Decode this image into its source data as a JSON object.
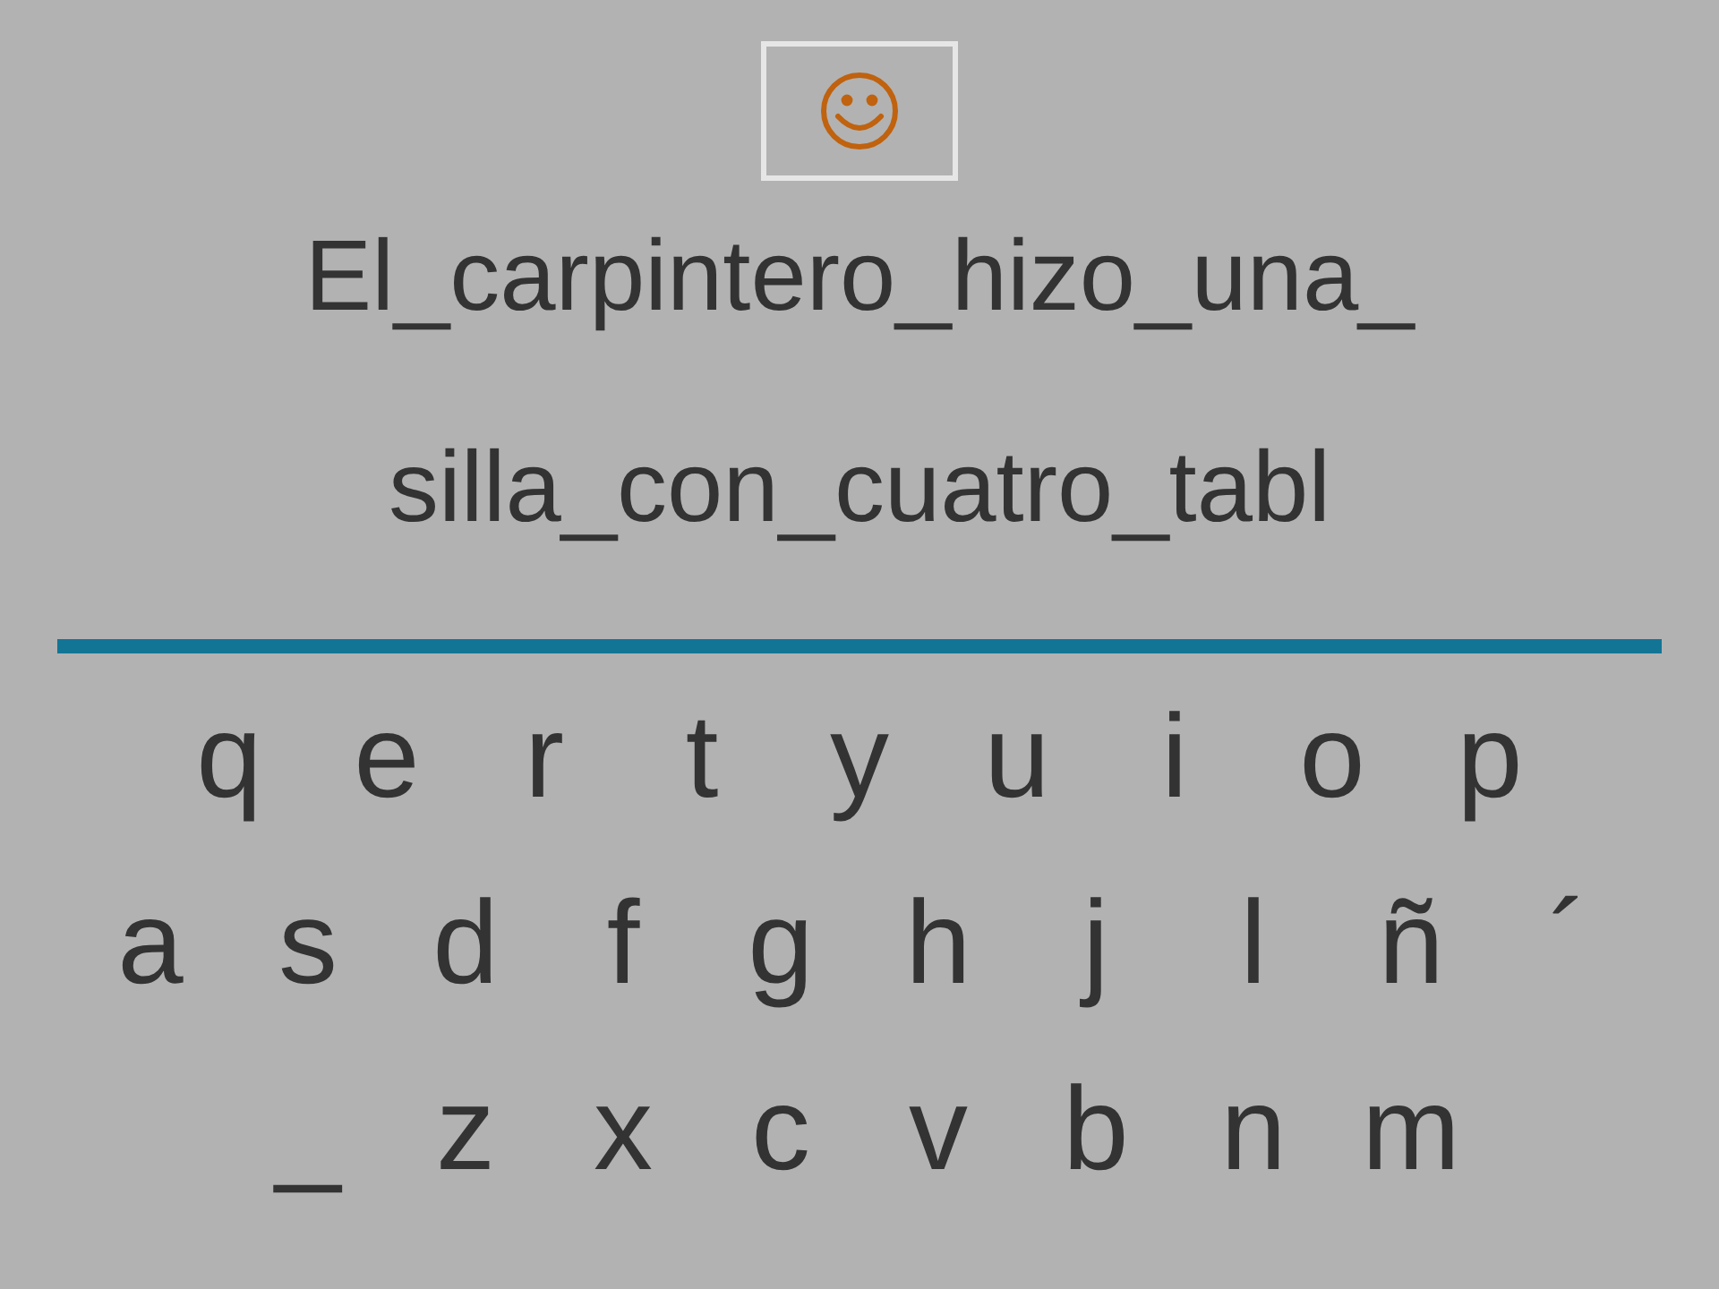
{
  "sentence_lines": [
    "El_carpintero_hizo_una_",
    "silla_con_cuatro_tabl"
  ],
  "keyboard_rows": [
    [
      "q",
      "e",
      "r",
      "t",
      "y",
      "u",
      "i",
      "o",
      "p"
    ],
    [
      "a",
      "s",
      "d",
      "f",
      "g",
      "h",
      "j",
      "l",
      "ñ",
      "´"
    ],
    [
      "_",
      "z",
      "x",
      "c",
      "v",
      "b",
      "n",
      "m"
    ]
  ]
}
